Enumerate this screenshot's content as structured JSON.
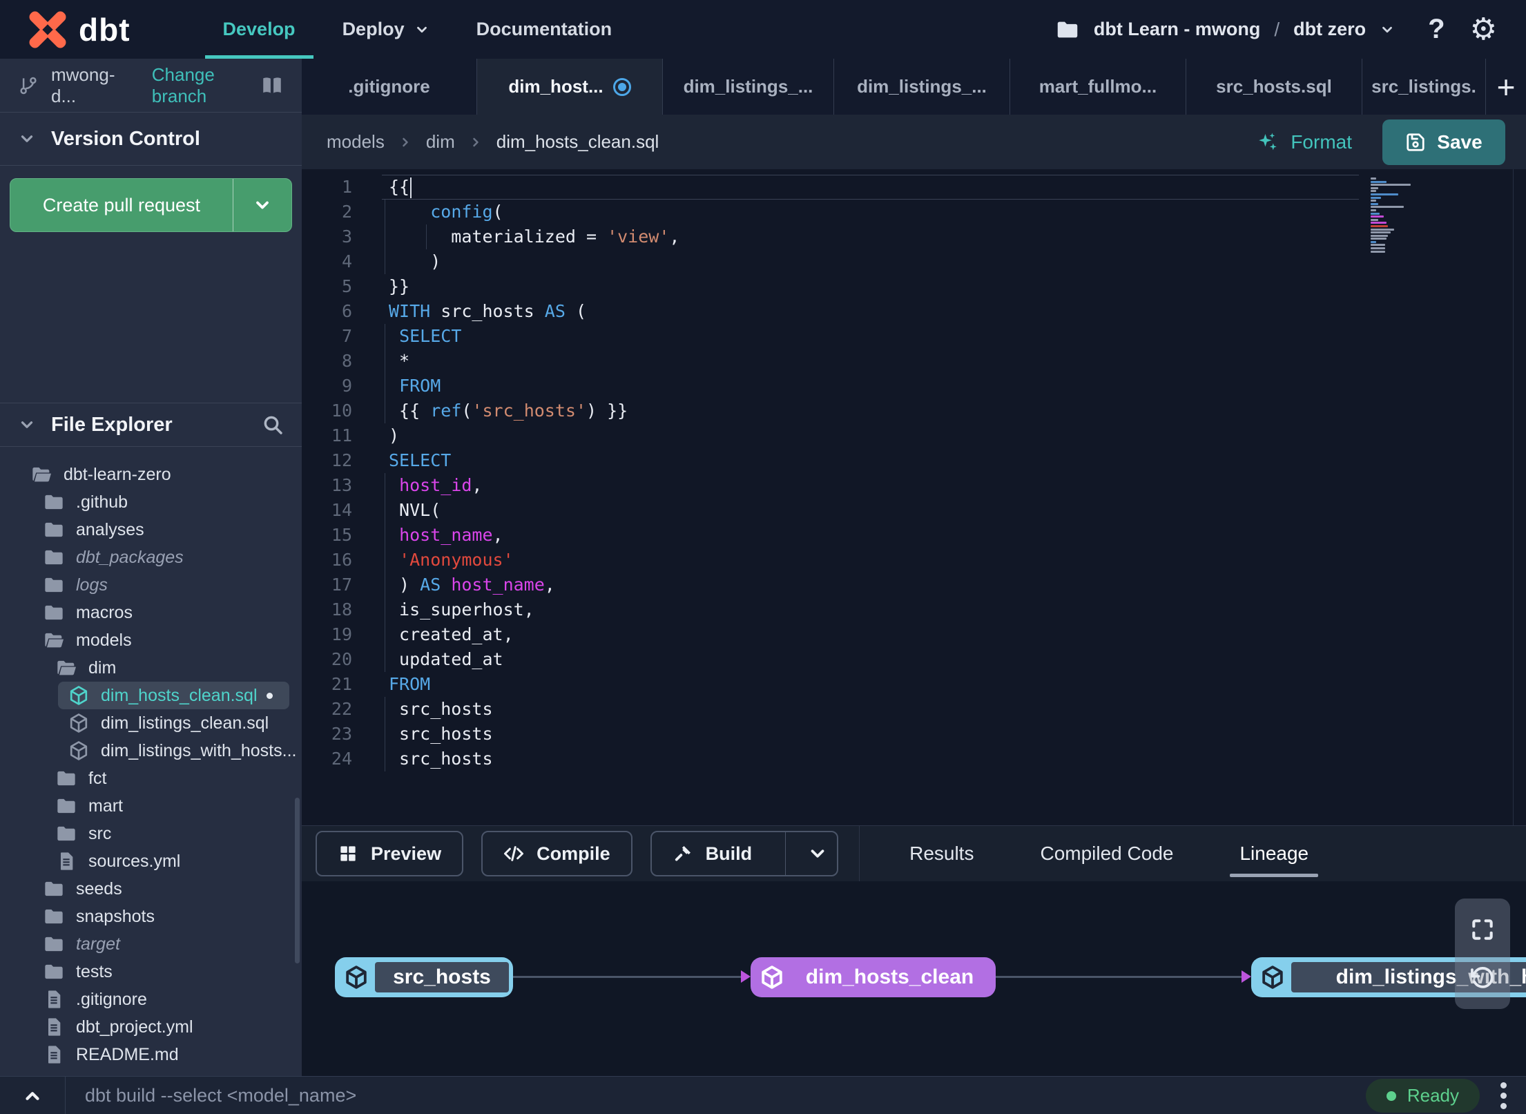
{
  "header": {
    "logo_text": "dbt",
    "nav": [
      {
        "label": "Develop",
        "active": true
      },
      {
        "label": "Deploy",
        "chevron": true
      },
      {
        "label": "Documentation"
      }
    ],
    "project": {
      "account": "dbt Learn - mwong",
      "separator": "/",
      "name": "dbt zero"
    }
  },
  "sidebar": {
    "branch": {
      "name": "mwong-d...",
      "change_link": "Change branch"
    },
    "version_control_title": "Version Control",
    "create_pr_label": "Create pull request",
    "file_explorer_title": "File Explorer",
    "tree": [
      {
        "label": "dbt-learn-zero",
        "type": "folder-open",
        "level": 0
      },
      {
        "label": ".github",
        "type": "folder",
        "level": 1
      },
      {
        "label": "analyses",
        "type": "folder",
        "level": 1
      },
      {
        "label": "dbt_packages",
        "type": "folder",
        "level": 1,
        "muted": true
      },
      {
        "label": "logs",
        "type": "folder",
        "level": 1,
        "muted": true
      },
      {
        "label": "macros",
        "type": "folder",
        "level": 1
      },
      {
        "label": "models",
        "type": "folder-open",
        "level": 1
      },
      {
        "label": "dim",
        "type": "folder-open",
        "level": 2
      },
      {
        "label": "dim_hosts_clean.sql",
        "type": "model",
        "level": 3,
        "selected": true,
        "modified": true
      },
      {
        "label": "dim_listings_clean.sql",
        "type": "model",
        "level": 3
      },
      {
        "label": "dim_listings_with_hosts...",
        "type": "model",
        "level": 3
      },
      {
        "label": "fct",
        "type": "folder",
        "level": 2
      },
      {
        "label": "mart",
        "type": "folder",
        "level": 2
      },
      {
        "label": "src",
        "type": "folder",
        "level": 2
      },
      {
        "label": "sources.yml",
        "type": "file",
        "level": 2
      },
      {
        "label": "seeds",
        "type": "folder",
        "level": 1
      },
      {
        "label": "snapshots",
        "type": "folder",
        "level": 1
      },
      {
        "label": "target",
        "type": "folder",
        "level": 1,
        "muted": true
      },
      {
        "label": "tests",
        "type": "folder",
        "level": 1
      },
      {
        "label": ".gitignore",
        "type": "file",
        "level": 1
      },
      {
        "label": "dbt_project.yml",
        "type": "file",
        "level": 1
      },
      {
        "label": "README.md",
        "type": "file",
        "level": 1
      }
    ]
  },
  "tabs": [
    {
      "label": ".gitignore"
    },
    {
      "label": "dim_host...",
      "active": true,
      "modified": true
    },
    {
      "label": "dim_listings_..."
    },
    {
      "label": "dim_listings_..."
    },
    {
      "label": "mart_fullmo..."
    },
    {
      "label": "src_hosts.sql"
    },
    {
      "label": "src_listings."
    }
  ],
  "editor": {
    "breadcrumb": [
      "models",
      "dim",
      "dim_hosts_clean.sql"
    ],
    "format_label": "Format",
    "save_label": "Save",
    "lines": [
      {
        "n": 1,
        "current": true,
        "cursor": true,
        "tokens": [
          [
            "p",
            "{{"
          ]
        ]
      },
      {
        "n": 2,
        "guides": [
          0
        ],
        "tokens": [
          [
            "p",
            "    "
          ],
          [
            "k",
            "config"
          ],
          [
            "p",
            "("
          ]
        ]
      },
      {
        "n": 3,
        "guides": [
          0,
          4
        ],
        "tokens": [
          [
            "p",
            "      materialized = "
          ],
          [
            "s",
            "'view'"
          ],
          [
            "p",
            ","
          ]
        ]
      },
      {
        "n": 4,
        "guides": [
          0
        ],
        "tokens": [
          [
            "p",
            "    )"
          ]
        ]
      },
      {
        "n": 5,
        "tokens": [
          [
            "p",
            "}}"
          ]
        ]
      },
      {
        "n": 6,
        "tokens": [
          [
            "k",
            "WITH"
          ],
          [
            "p",
            " src_hosts "
          ],
          [
            "k",
            "AS"
          ],
          [
            "p",
            " ("
          ]
        ]
      },
      {
        "n": 7,
        "guides": [
          0
        ],
        "tokens": [
          [
            "p",
            " "
          ],
          [
            "k",
            "SELECT"
          ]
        ]
      },
      {
        "n": 8,
        "guides": [
          0
        ],
        "tokens": [
          [
            "p",
            " *"
          ]
        ]
      },
      {
        "n": 9,
        "guides": [
          0
        ],
        "tokens": [
          [
            "p",
            " "
          ],
          [
            "k",
            "FROM"
          ]
        ]
      },
      {
        "n": 10,
        "guides": [
          0
        ],
        "tokens": [
          [
            "p",
            " {{ "
          ],
          [
            "k",
            "ref"
          ],
          [
            "p",
            "("
          ],
          [
            "s",
            "'src_hosts'"
          ],
          [
            "p",
            ") }}"
          ]
        ]
      },
      {
        "n": 11,
        "tokens": [
          [
            "p",
            ")"
          ]
        ]
      },
      {
        "n": 12,
        "tokens": [
          [
            "k",
            "SELECT"
          ]
        ]
      },
      {
        "n": 13,
        "guides": [
          0
        ],
        "tokens": [
          [
            "p",
            " "
          ],
          [
            "i",
            "host_id"
          ],
          [
            "p",
            ","
          ]
        ]
      },
      {
        "n": 14,
        "guides": [
          0
        ],
        "tokens": [
          [
            "p",
            " NVL("
          ]
        ]
      },
      {
        "n": 15,
        "guides": [
          0
        ],
        "tokens": [
          [
            "p",
            " "
          ],
          [
            "i",
            "host_name"
          ],
          [
            "p",
            ","
          ]
        ]
      },
      {
        "n": 16,
        "guides": [
          0
        ],
        "tokens": [
          [
            "p",
            " "
          ],
          [
            "r",
            "'Anonymous'"
          ]
        ]
      },
      {
        "n": 17,
        "guides": [
          0
        ],
        "tokens": [
          [
            "p",
            " ) "
          ],
          [
            "k",
            "AS"
          ],
          [
            "p",
            " "
          ],
          [
            "i",
            "host_name"
          ],
          [
            "p",
            ","
          ]
        ]
      },
      {
        "n": 18,
        "guides": [
          0
        ],
        "tokens": [
          [
            "p",
            " is_superhost,"
          ]
        ]
      },
      {
        "n": 19,
        "guides": [
          0
        ],
        "tokens": [
          [
            "p",
            " created_at,"
          ]
        ]
      },
      {
        "n": 20,
        "guides": [
          0
        ],
        "tokens": [
          [
            "p",
            " updated_at"
          ]
        ]
      },
      {
        "n": 21,
        "tokens": [
          [
            "k",
            "FROM"
          ]
        ]
      },
      {
        "n": 22,
        "guides": [
          0
        ],
        "tokens": [
          [
            "p",
            " src_hosts"
          ]
        ]
      },
      {
        "n": 23,
        "guides": [
          0
        ],
        "tokens": [
          [
            "p",
            " src_hosts"
          ]
        ]
      },
      {
        "n": 24,
        "guides": [
          0
        ],
        "tokens": [
          [
            "p",
            " src_hosts"
          ]
        ]
      }
    ]
  },
  "bottom_panel": {
    "actions": [
      {
        "label": "Preview"
      },
      {
        "label": "Compile"
      },
      {
        "label": "Build"
      }
    ],
    "tabs": [
      {
        "label": "Results"
      },
      {
        "label": "Compiled Code"
      },
      {
        "label": "Lineage",
        "active": true
      }
    ],
    "lineage": {
      "nodes": [
        {
          "label": "src_hosts",
          "color": "blue"
        },
        {
          "label": "dim_hosts_clean",
          "color": "purple"
        },
        {
          "label": "dim_listings_with_h",
          "color": "blue"
        }
      ]
    }
  },
  "command_bar": {
    "placeholder": "dbt build --select <model_name>",
    "status": "Ready"
  },
  "colors": {
    "accent_teal": "#45c4bd",
    "pr_green": "#479d6d",
    "save_teal": "#2e7077",
    "node_blue": "#85cfec",
    "node_purple": "#b26fe3",
    "status_green": "#5dd08d",
    "modified_blue": "#4da7e8"
  }
}
